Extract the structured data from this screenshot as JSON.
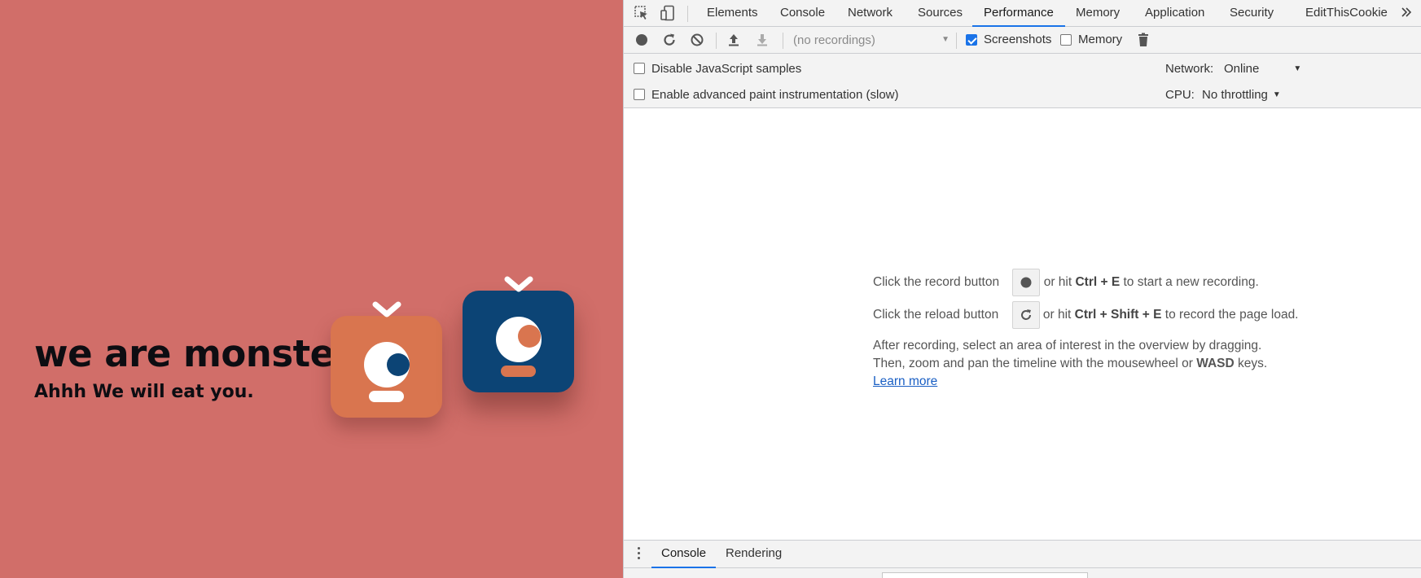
{
  "page": {
    "title": "we are monster",
    "subtitle": "Ahhh We will eat you.",
    "colors": {
      "background": "#d16e69",
      "monster_orange": "#d9754f",
      "monster_blue": "#0c4475"
    }
  },
  "devtools": {
    "icons": {
      "inspect": "inspect-element-icon",
      "device": "device-toolbar-icon",
      "more": "more-tabs-icon"
    },
    "tabs": [
      {
        "label": "Elements"
      },
      {
        "label": "Console"
      },
      {
        "label": "Network"
      },
      {
        "label": "Sources"
      },
      {
        "label": "Performance"
      },
      {
        "label": "Memory"
      },
      {
        "label": "Application"
      },
      {
        "label": "Security"
      },
      {
        "label": "EditThisCookie"
      }
    ],
    "active_tab": "Performance",
    "toolbar": {
      "recordings_select": "(no recordings)",
      "screenshots_label": "Screenshots",
      "screenshots_checked": true,
      "memory_label": "Memory",
      "memory_checked": false
    },
    "settings": {
      "disable_js_samples": "Disable JavaScript samples",
      "advanced_paint": "Enable advanced paint instrumentation (slow)",
      "network_label": "Network:",
      "network_value": "Online",
      "cpu_label": "CPU:",
      "cpu_value": "No throttling"
    },
    "landing": {
      "record_pre": "Click the record button",
      "record_mid": "or hit",
      "record_keys": "Ctrl + E",
      "record_post": "to start a new recording.",
      "reload_pre": "Click the reload button",
      "reload_mid": "or hit",
      "reload_keys": "Ctrl + Shift + E",
      "reload_post": "to record the page load.",
      "after_line1": "After recording, select an area of interest in the overview by dragging.",
      "after_line2_pre": "Then, zoom and pan the timeline with the mousewheel or",
      "after_line2_keys": "WASD",
      "after_line2_post": "keys.",
      "learn_more": "Learn more"
    },
    "drawer": {
      "tabs": [
        {
          "label": "Console"
        },
        {
          "label": "Rendering"
        }
      ]
    }
  }
}
